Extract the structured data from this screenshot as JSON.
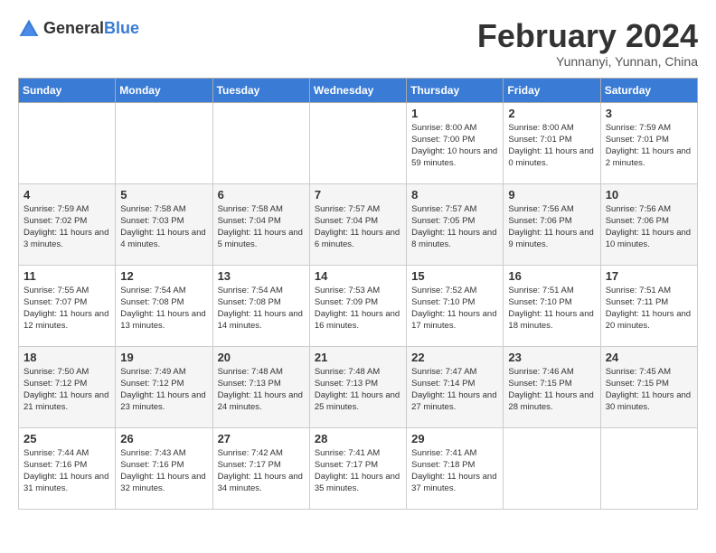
{
  "logo": {
    "general": "General",
    "blue": "Blue"
  },
  "title": "February 2024",
  "subtitle": "Yunnanyi, Yunnan, China",
  "days_of_week": [
    "Sunday",
    "Monday",
    "Tuesday",
    "Wednesday",
    "Thursday",
    "Friday",
    "Saturday"
  ],
  "weeks": [
    [
      {
        "day": "",
        "sunrise": "",
        "sunset": "",
        "daylight": ""
      },
      {
        "day": "",
        "sunrise": "",
        "sunset": "",
        "daylight": ""
      },
      {
        "day": "",
        "sunrise": "",
        "sunset": "",
        "daylight": ""
      },
      {
        "day": "",
        "sunrise": "",
        "sunset": "",
        "daylight": ""
      },
      {
        "day": "1",
        "sunrise": "Sunrise: 8:00 AM",
        "sunset": "Sunset: 7:00 PM",
        "daylight": "Daylight: 10 hours and 59 minutes."
      },
      {
        "day": "2",
        "sunrise": "Sunrise: 8:00 AM",
        "sunset": "Sunset: 7:01 PM",
        "daylight": "Daylight: 11 hours and 0 minutes."
      },
      {
        "day": "3",
        "sunrise": "Sunrise: 7:59 AM",
        "sunset": "Sunset: 7:01 PM",
        "daylight": "Daylight: 11 hours and 2 minutes."
      }
    ],
    [
      {
        "day": "4",
        "sunrise": "Sunrise: 7:59 AM",
        "sunset": "Sunset: 7:02 PM",
        "daylight": "Daylight: 11 hours and 3 minutes."
      },
      {
        "day": "5",
        "sunrise": "Sunrise: 7:58 AM",
        "sunset": "Sunset: 7:03 PM",
        "daylight": "Daylight: 11 hours and 4 minutes."
      },
      {
        "day": "6",
        "sunrise": "Sunrise: 7:58 AM",
        "sunset": "Sunset: 7:04 PM",
        "daylight": "Daylight: 11 hours and 5 minutes."
      },
      {
        "day": "7",
        "sunrise": "Sunrise: 7:57 AM",
        "sunset": "Sunset: 7:04 PM",
        "daylight": "Daylight: 11 hours and 6 minutes."
      },
      {
        "day": "8",
        "sunrise": "Sunrise: 7:57 AM",
        "sunset": "Sunset: 7:05 PM",
        "daylight": "Daylight: 11 hours and 8 minutes."
      },
      {
        "day": "9",
        "sunrise": "Sunrise: 7:56 AM",
        "sunset": "Sunset: 7:06 PM",
        "daylight": "Daylight: 11 hours and 9 minutes."
      },
      {
        "day": "10",
        "sunrise": "Sunrise: 7:56 AM",
        "sunset": "Sunset: 7:06 PM",
        "daylight": "Daylight: 11 hours and 10 minutes."
      }
    ],
    [
      {
        "day": "11",
        "sunrise": "Sunrise: 7:55 AM",
        "sunset": "Sunset: 7:07 PM",
        "daylight": "Daylight: 11 hours and 12 minutes."
      },
      {
        "day": "12",
        "sunrise": "Sunrise: 7:54 AM",
        "sunset": "Sunset: 7:08 PM",
        "daylight": "Daylight: 11 hours and 13 minutes."
      },
      {
        "day": "13",
        "sunrise": "Sunrise: 7:54 AM",
        "sunset": "Sunset: 7:08 PM",
        "daylight": "Daylight: 11 hours and 14 minutes."
      },
      {
        "day": "14",
        "sunrise": "Sunrise: 7:53 AM",
        "sunset": "Sunset: 7:09 PM",
        "daylight": "Daylight: 11 hours and 16 minutes."
      },
      {
        "day": "15",
        "sunrise": "Sunrise: 7:52 AM",
        "sunset": "Sunset: 7:10 PM",
        "daylight": "Daylight: 11 hours and 17 minutes."
      },
      {
        "day": "16",
        "sunrise": "Sunrise: 7:51 AM",
        "sunset": "Sunset: 7:10 PM",
        "daylight": "Daylight: 11 hours and 18 minutes."
      },
      {
        "day": "17",
        "sunrise": "Sunrise: 7:51 AM",
        "sunset": "Sunset: 7:11 PM",
        "daylight": "Daylight: 11 hours and 20 minutes."
      }
    ],
    [
      {
        "day": "18",
        "sunrise": "Sunrise: 7:50 AM",
        "sunset": "Sunset: 7:12 PM",
        "daylight": "Daylight: 11 hours and 21 minutes."
      },
      {
        "day": "19",
        "sunrise": "Sunrise: 7:49 AM",
        "sunset": "Sunset: 7:12 PM",
        "daylight": "Daylight: 11 hours and 23 minutes."
      },
      {
        "day": "20",
        "sunrise": "Sunrise: 7:48 AM",
        "sunset": "Sunset: 7:13 PM",
        "daylight": "Daylight: 11 hours and 24 minutes."
      },
      {
        "day": "21",
        "sunrise": "Sunrise: 7:48 AM",
        "sunset": "Sunset: 7:13 PM",
        "daylight": "Daylight: 11 hours and 25 minutes."
      },
      {
        "day": "22",
        "sunrise": "Sunrise: 7:47 AM",
        "sunset": "Sunset: 7:14 PM",
        "daylight": "Daylight: 11 hours and 27 minutes."
      },
      {
        "day": "23",
        "sunrise": "Sunrise: 7:46 AM",
        "sunset": "Sunset: 7:15 PM",
        "daylight": "Daylight: 11 hours and 28 minutes."
      },
      {
        "day": "24",
        "sunrise": "Sunrise: 7:45 AM",
        "sunset": "Sunset: 7:15 PM",
        "daylight": "Daylight: 11 hours and 30 minutes."
      }
    ],
    [
      {
        "day": "25",
        "sunrise": "Sunrise: 7:44 AM",
        "sunset": "Sunset: 7:16 PM",
        "daylight": "Daylight: 11 hours and 31 minutes."
      },
      {
        "day": "26",
        "sunrise": "Sunrise: 7:43 AM",
        "sunset": "Sunset: 7:16 PM",
        "daylight": "Daylight: 11 hours and 32 minutes."
      },
      {
        "day": "27",
        "sunrise": "Sunrise: 7:42 AM",
        "sunset": "Sunset: 7:17 PM",
        "daylight": "Daylight: 11 hours and 34 minutes."
      },
      {
        "day": "28",
        "sunrise": "Sunrise: 7:41 AM",
        "sunset": "Sunset: 7:17 PM",
        "daylight": "Daylight: 11 hours and 35 minutes."
      },
      {
        "day": "29",
        "sunrise": "Sunrise: 7:41 AM",
        "sunset": "Sunset: 7:18 PM",
        "daylight": "Daylight: 11 hours and 37 minutes."
      },
      {
        "day": "",
        "sunrise": "",
        "sunset": "",
        "daylight": ""
      },
      {
        "day": "",
        "sunrise": "",
        "sunset": "",
        "daylight": ""
      }
    ]
  ]
}
